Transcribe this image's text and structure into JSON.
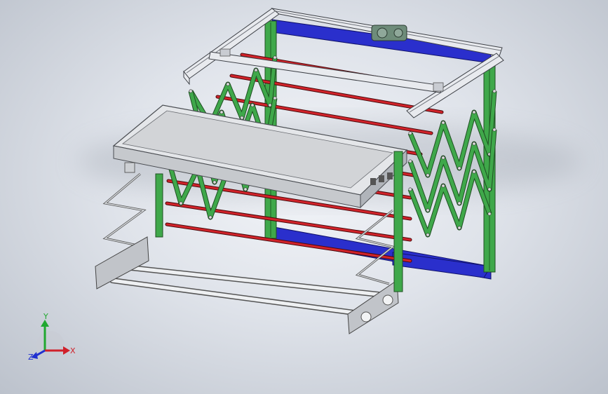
{
  "viewport": {
    "background_center": "#f3f5f9",
    "background_edge": "#bcc2cc"
  },
  "model": {
    "frame_color": "#e8eaee",
    "scissor_color": "#3fa84a",
    "rod_color": "#d2232a",
    "beam_color": "#2a2fcc",
    "panel_color": "#d4d6d8",
    "bottom_rod_color": "#d9dcdf",
    "bracket_color": "#b8bcc2"
  },
  "triad": {
    "x_label": "X",
    "y_label": "Y",
    "z_label": "Z",
    "x_color": "#d0202a",
    "y_color": "#20a830",
    "z_color": "#2030d0"
  }
}
